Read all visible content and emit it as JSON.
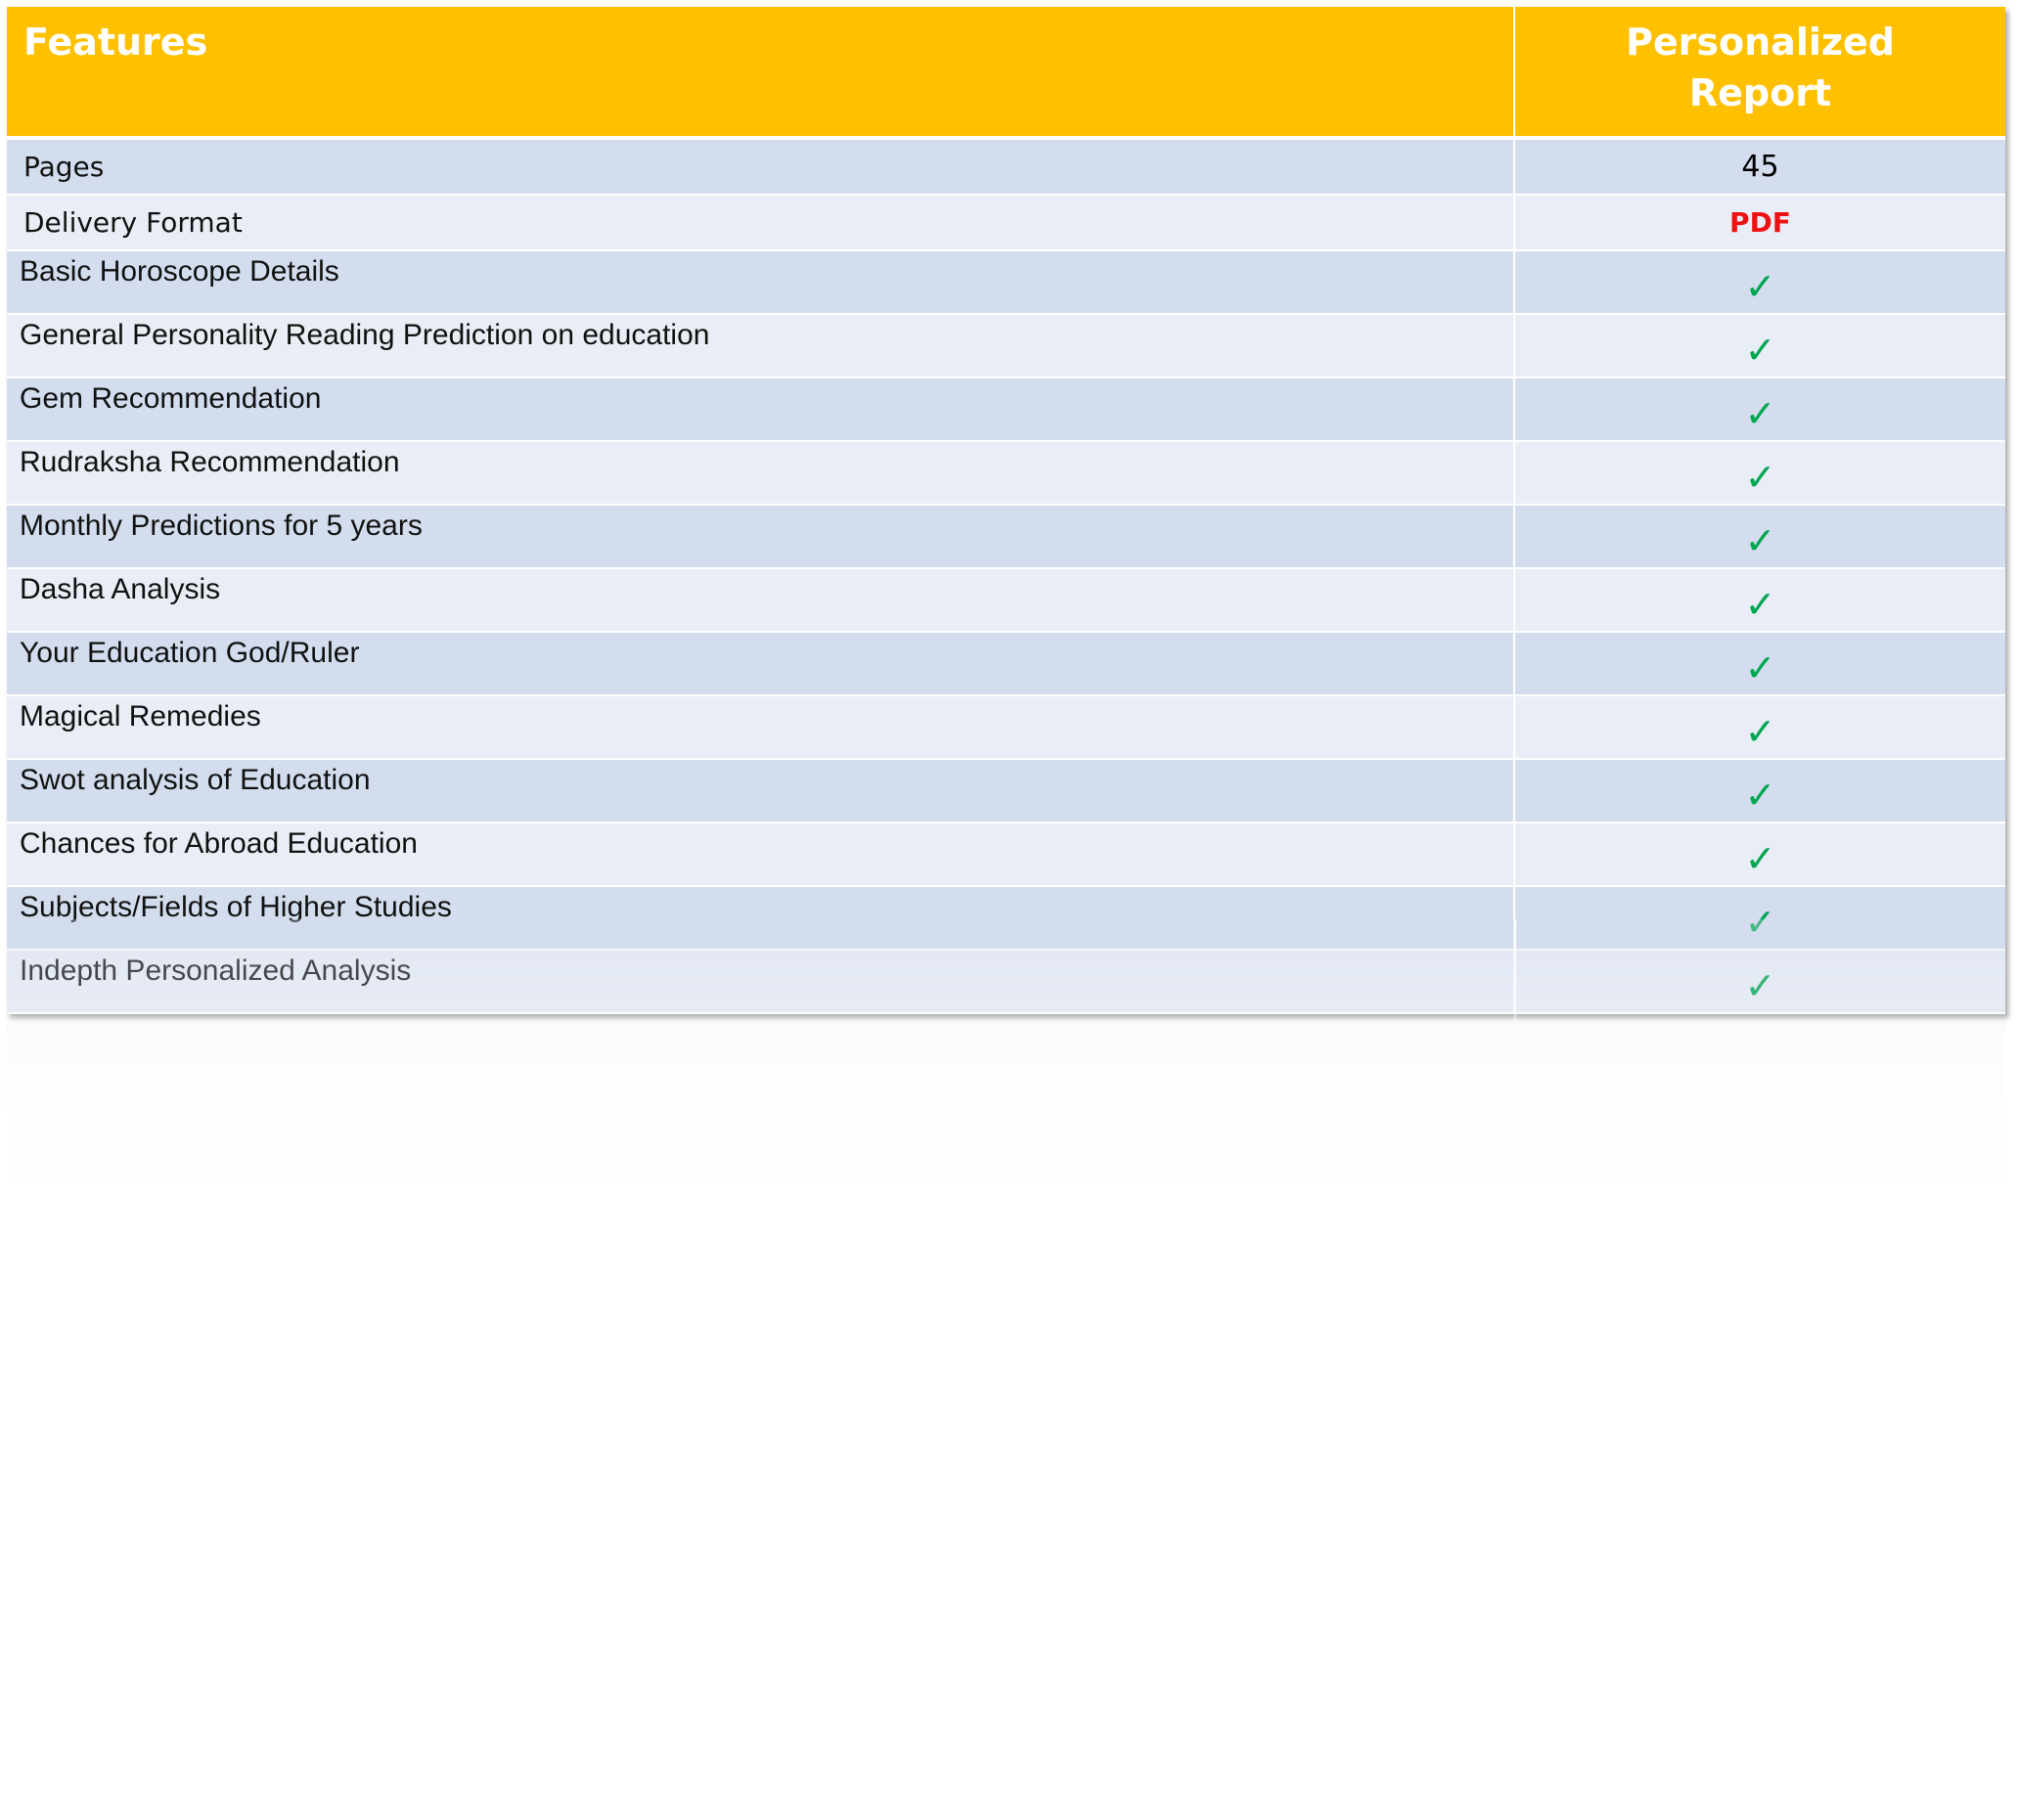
{
  "table": {
    "headers": {
      "feature": "Features",
      "report_line1": "Personalized",
      "report_line2": "Report"
    },
    "rows": [
      {
        "feature": "Pages",
        "value": "45",
        "kind": "text",
        "font": "calibri"
      },
      {
        "feature": "Delivery Format",
        "value": "PDF",
        "kind": "pdf",
        "font": "calibri"
      },
      {
        "feature": "Basic Horoscope Details",
        "value": "✓",
        "kind": "check",
        "font": "arial"
      },
      {
        "feature": "General Personality Reading Prediction on education",
        "value": "✓",
        "kind": "check",
        "font": "arial"
      },
      {
        "feature": "Gem Recommendation",
        "value": "✓",
        "kind": "check",
        "font": "arial"
      },
      {
        "feature": "Rudraksha Recommendation",
        "value": "✓",
        "kind": "check",
        "font": "arial"
      },
      {
        "feature": "Monthly Predictions for 5 years",
        "value": "✓",
        "kind": "check",
        "font": "arial"
      },
      {
        "feature": "Dasha Analysis",
        "value": "✓",
        "kind": "check",
        "font": "arial"
      },
      {
        "feature": "Your Education God/Ruler",
        "value": "✓",
        "kind": "check",
        "font": "arial"
      },
      {
        "feature": "Magical Remedies",
        "value": "✓",
        "kind": "check",
        "font": "arial"
      },
      {
        "feature": "Swot analysis of Education",
        "value": "✓",
        "kind": "check",
        "font": "arial"
      },
      {
        "feature": "Chances for Abroad Education",
        "value": "✓",
        "kind": "check",
        "font": "arial"
      },
      {
        "feature": "Subjects/Fields of Higher Studies",
        "value": "✓",
        "kind": "check",
        "font": "arial"
      },
      {
        "feature": "Indepth Personalized Analysis",
        "value": "✓",
        "kind": "check",
        "font": "arial"
      }
    ]
  },
  "colors": {
    "header_bg": "#FFC000",
    "header_text": "#FFFFFF",
    "row_odd": "#D3DDED",
    "row_even": "#E9EDF5",
    "check": "#00A651",
    "pdf": "#EE1111"
  },
  "icons": {
    "check": "check-icon"
  }
}
